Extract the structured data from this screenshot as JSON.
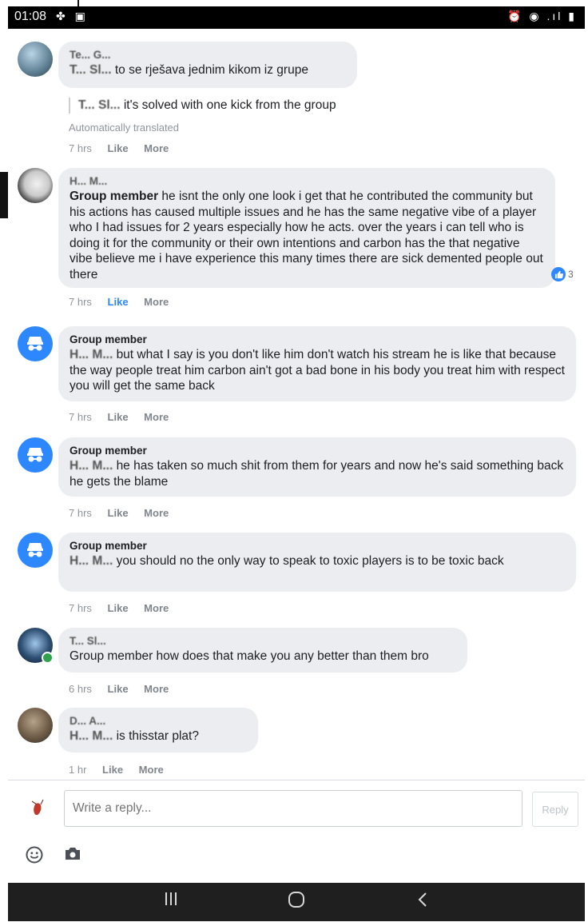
{
  "status_bar": {
    "time": "01:08",
    "left_icons": "✤ ▣",
    "right_icons": "⏰ ◉ .ıl ▮"
  },
  "comments": [
    {
      "author": "Te... G...",
      "mention": "T...  Sl...",
      "text": "to se rješava jednim kikom iz grupe",
      "translation_mention": "T...  Sl...",
      "translation": "it's solved with one kick from the group",
      "auto_translated": "Automatically translated",
      "time": "7 hrs",
      "like": "Like",
      "more": "More"
    },
    {
      "author": "H...  M...",
      "badge": "Group member",
      "text": "he isnt the only one look i get that he contributed the community but his actions has caused multiple issues and he has the same negative vibe of a player who I had issues for 2 years especially how he acts. over the years i can tell who is doing it for the community or their own intentions and carbon has the that negative vibe believe me i have experience this many times there are sick demented people out there",
      "reaction_count": "3",
      "time": "7 hrs",
      "like": "Like",
      "more": "More"
    },
    {
      "author": "Group member",
      "mention": "H...  M...",
      "text": "but what I say is you don't like him don't watch his stream he is like that because the way people treat him carbon ain't got a bad bone in his body you treat him with respect you will get the same back",
      "time": "7 hrs",
      "like": "Like",
      "more": "More"
    },
    {
      "author": "Group member",
      "mention": "H...  M...",
      "text": "he has taken so much shit from them for years and now he's said something back he gets the blame",
      "time": "7 hrs",
      "like": "Like",
      "more": "More"
    },
    {
      "author": "Group member",
      "mention": "H...  M...",
      "text": "you should no the only way to speak to toxic players is to be toxic back",
      "time": "7 hrs",
      "like": "Like",
      "more": "More"
    },
    {
      "author": "T...  Sl...",
      "text": "Group member how does that make you any better than them bro",
      "time": "6 hrs",
      "like": "Like",
      "more": "More"
    },
    {
      "author": "D...  A...",
      "mention": "H...  M...",
      "text": "is thisstar plat?",
      "time": "1 hr",
      "like": "Like",
      "more": "More"
    }
  ],
  "composer": {
    "placeholder": "Write a reply...",
    "reply_label": "Reply"
  },
  "icons": {
    "emoji": "emoji-icon",
    "camera": "camera-icon",
    "nav_recent": "recent-apps-icon",
    "nav_home": "home-icon",
    "nav_back": "back-icon"
  },
  "colors": {
    "accent": "#2d88ff",
    "bubble": "#ebedf0",
    "meta": "#90949c"
  }
}
